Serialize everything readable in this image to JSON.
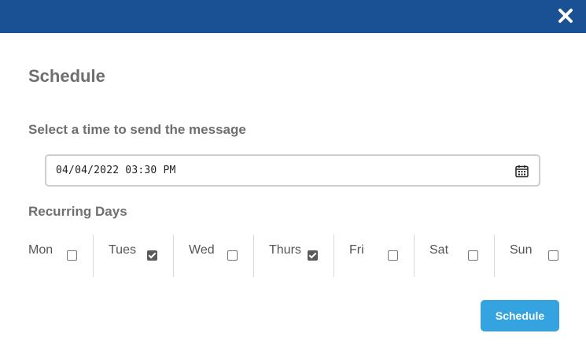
{
  "header": {
    "bar_color": "#1a5194",
    "close_icon": "close-icon"
  },
  "dialog": {
    "title": "Schedule",
    "time_prompt": "Select a time to send the message",
    "datetime_value": "04/04/2022 03:30 PM",
    "calendar_icon": "calendar-icon",
    "recurring_label": "Recurring Days",
    "days": [
      {
        "label": "Mon",
        "checked": false
      },
      {
        "label": "Tues",
        "checked": true
      },
      {
        "label": "Wed",
        "checked": false
      },
      {
        "label": "Thurs",
        "checked": true
      },
      {
        "label": "Fri",
        "checked": false
      },
      {
        "label": "Sat",
        "checked": false
      },
      {
        "label": "Sun",
        "checked": false
      }
    ],
    "submit_label": "Schedule",
    "submit_color": "#35a3e0"
  }
}
